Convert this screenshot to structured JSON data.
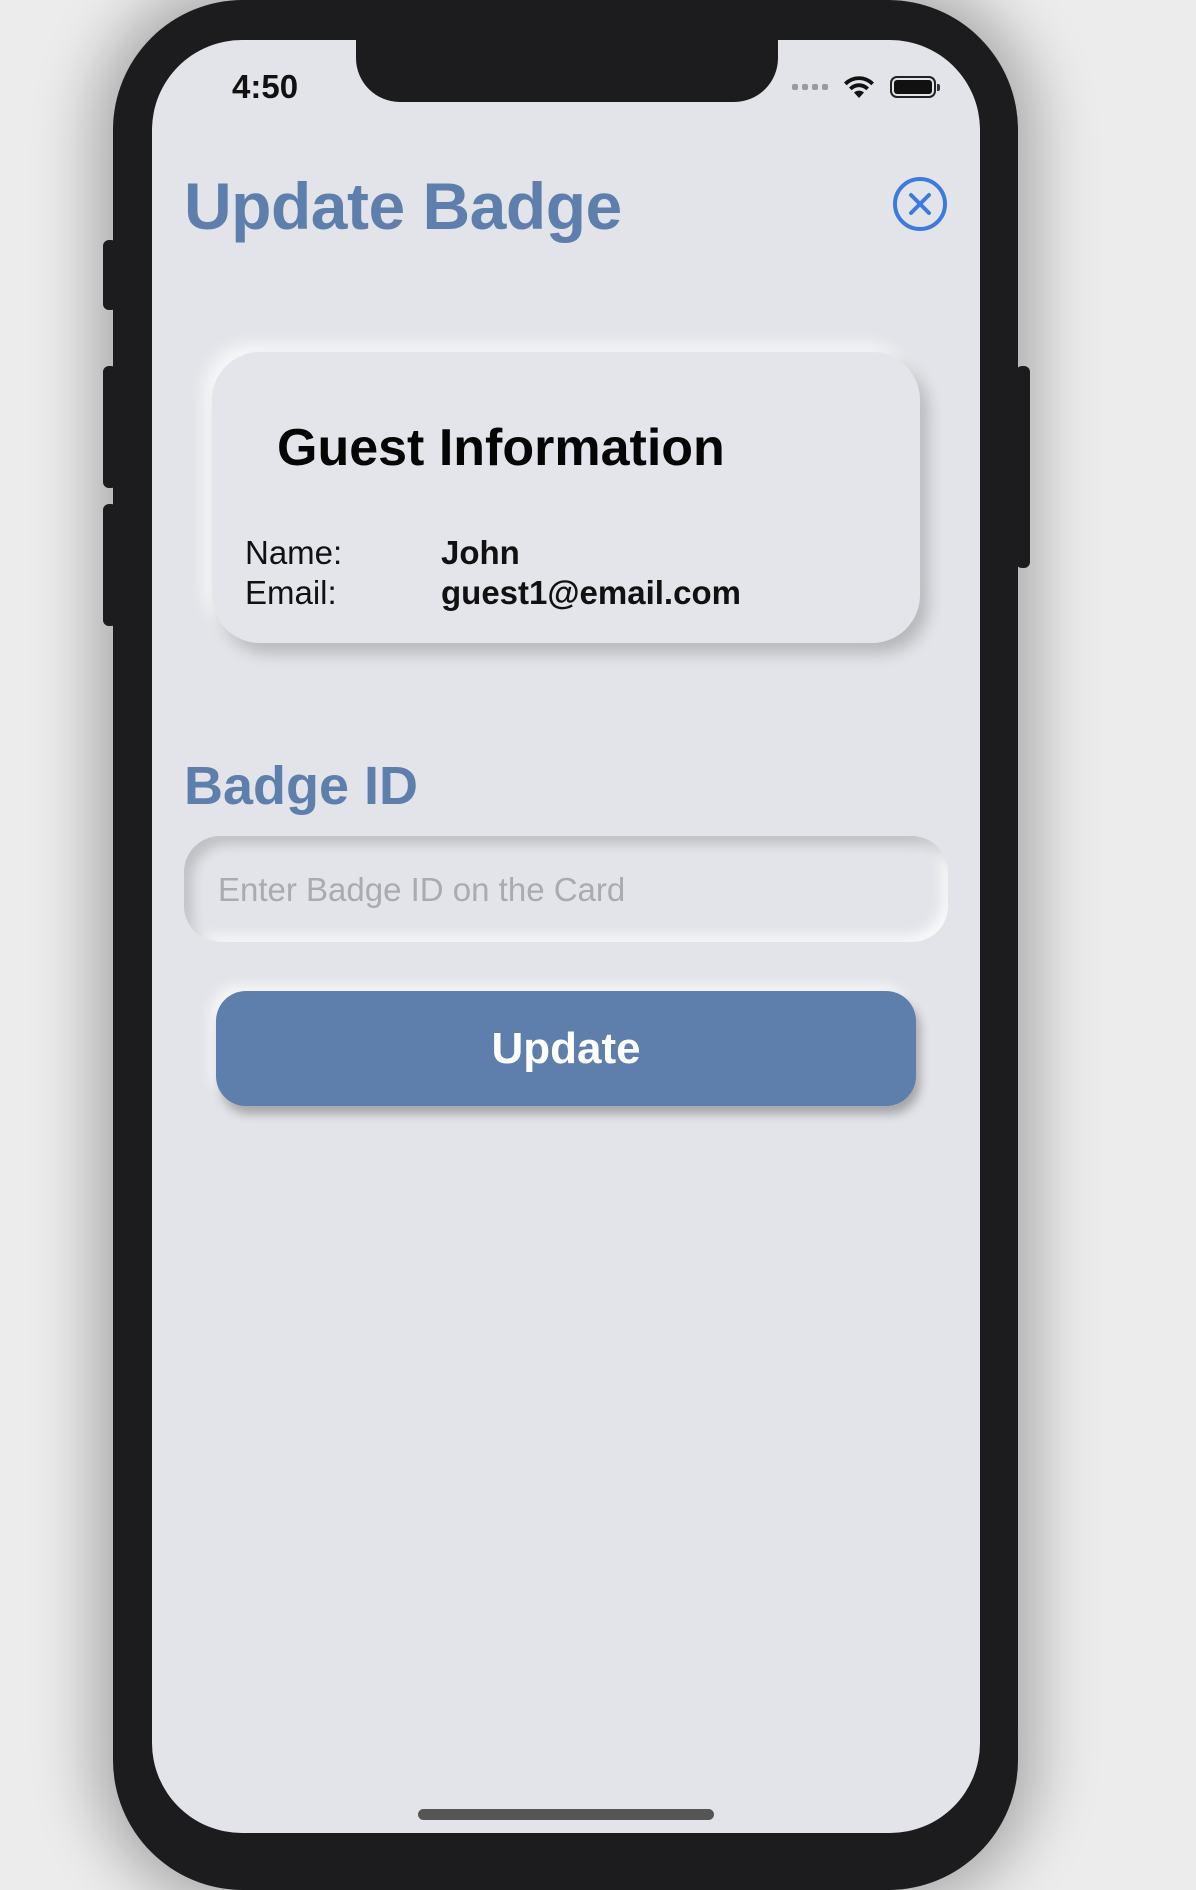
{
  "status_bar": {
    "time": "4:50"
  },
  "header": {
    "title": "Update Badge",
    "close_icon": "close-circle-icon"
  },
  "guest_card": {
    "title": "Guest Information",
    "name_label": "Name:",
    "name_value": "John",
    "email_label": "Email:",
    "email_value": "guest1@email.com"
  },
  "badge_section": {
    "label": "Badge ID",
    "input_value": "",
    "input_placeholder": "Enter Badge ID on the Card"
  },
  "actions": {
    "update_label": "Update"
  },
  "colors": {
    "accent": "#5e7fac",
    "close_icon": "#3b7be0",
    "background": "#e3e4e9"
  }
}
